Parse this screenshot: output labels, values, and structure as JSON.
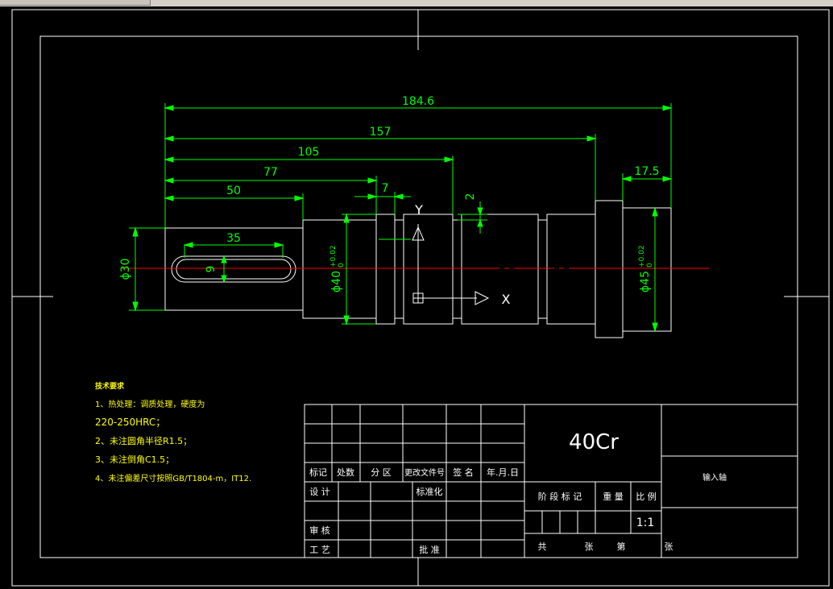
{
  "colors": {
    "background": "#000000",
    "outline": "#ffffff",
    "dimension": "#00ff00",
    "centerline": "#ff0000",
    "notes": "#ffff00"
  },
  "dimensions": {
    "overall": "184.6",
    "d157": "157",
    "d105": "105",
    "d77": "77",
    "d50": "50",
    "d7": "7",
    "d2": "2",
    "d17_5": "17.5",
    "key_length": "35",
    "key_width": "9",
    "dia30": "ϕ30",
    "dia40": "ϕ40",
    "dia40_tol": "+0.02",
    "dia40_tol2": "0",
    "dia45": "ϕ45",
    "dia45_tol": "+0.02",
    "dia45_tol2": "0"
  },
  "ucs": {
    "y_label": "Y",
    "x_label": "X"
  },
  "notes": {
    "title": "技术要求",
    "items": [
      "1、热处理：调质处理，硬度为",
      "220-250HRC；",
      "2、未注圆角半径R1.5；",
      "3、未注倒角C1.5；",
      "4、未注偏差尺寸按照GB/T1804-m，IT12."
    ]
  },
  "title_block": {
    "material": "40Cr",
    "part_name": "输入轴",
    "scale": "1:1",
    "rev_header": [
      "标记",
      "处数",
      "分 区",
      "更改文件号",
      "签 名",
      "年.月.日"
    ],
    "design": "设 计",
    "standard": "标准化",
    "review": "审 核",
    "process": "工 艺",
    "approve": "批 准",
    "stage_mark": "阶 段 标 记",
    "weight": "重 量",
    "scale_label": "比 例",
    "total": "共",
    "sheets": "张",
    "sheet_no": "第",
    "sheet_unit": "张"
  }
}
